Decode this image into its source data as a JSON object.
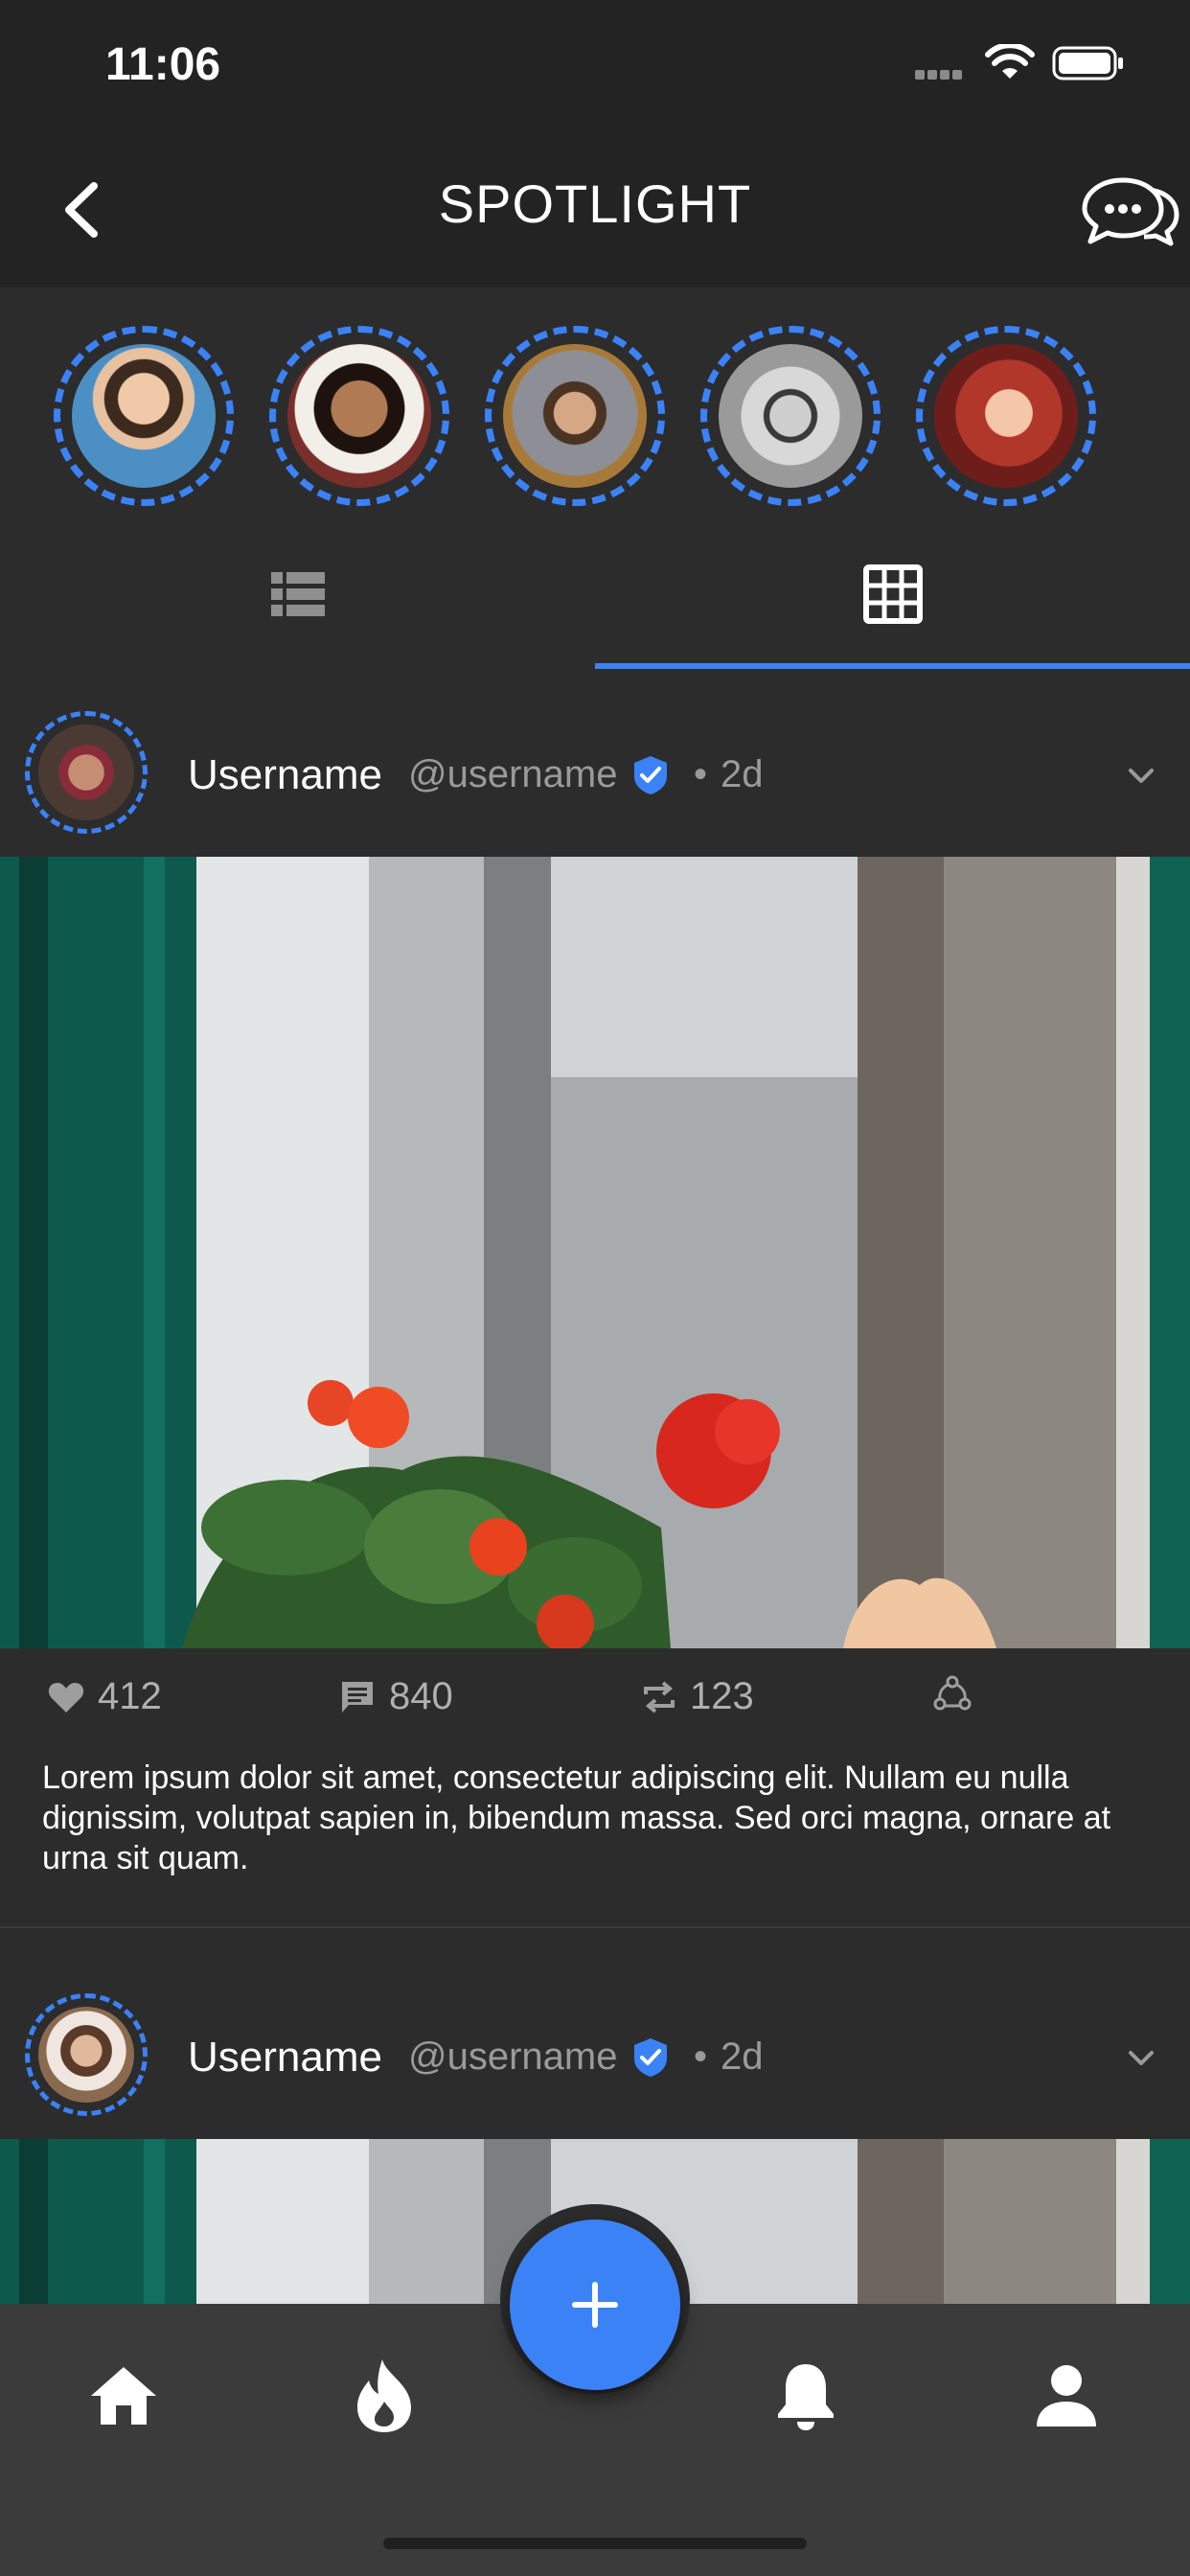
{
  "status_bar": {
    "time": "11:06"
  },
  "header": {
    "title": "SPOTLIGHT"
  },
  "stories": [
    {
      "name": "story-1"
    },
    {
      "name": "story-2"
    },
    {
      "name": "story-3"
    },
    {
      "name": "story-4"
    },
    {
      "name": "story-5"
    }
  ],
  "tabs": {
    "active": "grid"
  },
  "posts": [
    {
      "username": "Username",
      "handle": "@username",
      "time": "2d",
      "likes": "412",
      "comments": "840",
      "reposts": "123",
      "caption": "Lorem ipsum dolor sit amet, consectetur adipiscing elit. Nullam eu nulla dignissim, volutpat sapien in, bibendum massa. Sed orci magna, ornare at urna sit quam."
    },
    {
      "username": "Username",
      "handle": "@username",
      "time": "2d"
    }
  ],
  "colors": {
    "accent": "#3b82f6",
    "background": "#2c2c2d",
    "header": "#232324",
    "nav": "#3b3b3c"
  }
}
